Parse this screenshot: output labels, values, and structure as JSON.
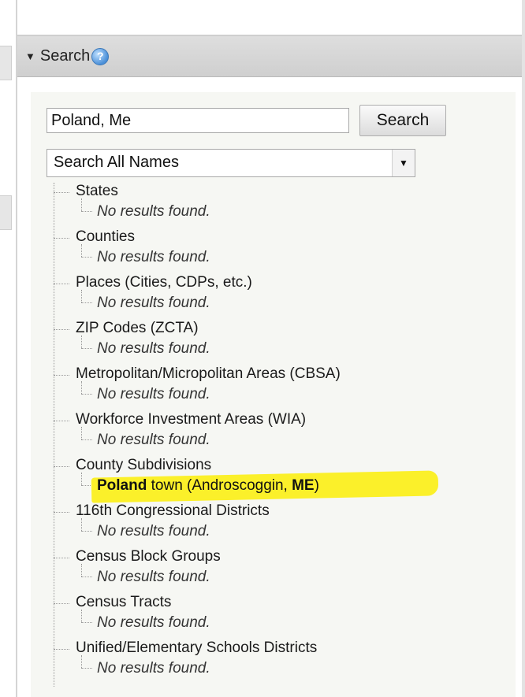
{
  "panel": {
    "title": "Search",
    "colors": {
      "header_bg": "#d6d6d6",
      "highlight": "#fbf02a",
      "help_icon": "#4a8fd8"
    }
  },
  "search": {
    "input_value": "Poland, Me",
    "button_label": "Search",
    "scope_selected": "Search All Names"
  },
  "results": [
    {
      "category": "States",
      "message": "No results found."
    },
    {
      "category": "Counties",
      "message": "No results found."
    },
    {
      "category": "Places (Cities, CDPs, etc.)",
      "message": "No results found."
    },
    {
      "category": "ZIP Codes (ZCTA)",
      "message": "No results found."
    },
    {
      "category": "Metropolitan/Micropolitan Areas (CBSA)",
      "message": "No results found."
    },
    {
      "category": "Workforce Investment Areas (WIA)",
      "message": "No results found."
    },
    {
      "category": "County Subdivisions",
      "match": {
        "name_bold": "Poland",
        "name_rest": " town (Androscoggin, ",
        "state_bold": "ME",
        "close": ")"
      }
    },
    {
      "category": "116th Congressional Districts",
      "message": "No results found."
    },
    {
      "category": "Census Block Groups",
      "message": "No results found."
    },
    {
      "category": "Census Tracts",
      "message": "No results found."
    },
    {
      "category": "Unified/Elementary Schools Districts",
      "message": "No results found."
    }
  ],
  "icons": {
    "collapse": "caret-down-icon",
    "help": "help-icon",
    "dropdown": "dropdown-arrow-icon"
  }
}
